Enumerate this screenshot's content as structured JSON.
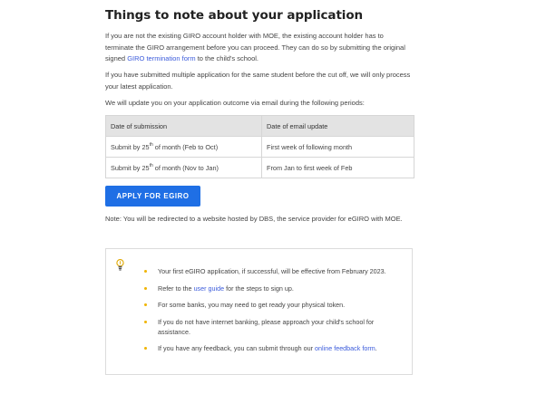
{
  "heading": "Things to note about your application",
  "para1": {
    "before": "If you are not the existing GIRO account holder with MOE, the existing account holder has to terminate the GIRO arrangement before you can proceed. They can do so by submitting the original signed ",
    "link": "GIRO termination form",
    "after": " to the child's school."
  },
  "para2": "If you have submitted multiple application for the same student before the cut off, we will only process your latest application.",
  "para3": "We will update you on your application outcome via email during the following periods:",
  "table": {
    "headers": [
      "Date of submission",
      "Date of email update"
    ],
    "rows": [
      {
        "sub_before": "Submit by 25",
        "sup": "th",
        "sub_after": " of month (Feb to Oct)",
        "update": "First week of following month"
      },
      {
        "sub_before": "Submit by 25",
        "sup": "th",
        "sub_after": " of month (Nov to Jan)",
        "update": "From Jan to first week of Feb"
      }
    ]
  },
  "apply_button": "APPLY FOR EGIRO",
  "redirect_note": "Note: You will be redirected to a website hosted by DBS, the service provider for eGIRO with MOE.",
  "notes": {
    "icon": "lightbulb-icon",
    "items": [
      {
        "text": "Your first eGIRO application, if successful, will be effective from February 2023."
      },
      {
        "before": "Refer to the ",
        "link": "user guide",
        "after": " for the steps to sign up."
      },
      {
        "text": "For some banks, you may need to get ready your physical token."
      },
      {
        "text": "If you do not have internet banking, please approach your child's school for assistance."
      },
      {
        "before": "If you have any feedback, you can submit through our ",
        "link": "online feedback form",
        "after": "."
      }
    ]
  },
  "colors": {
    "accent": "#1f6fe5",
    "link": "#3b5bdb",
    "bullet": "#f0b400",
    "table_header": "#e3e3e3"
  }
}
